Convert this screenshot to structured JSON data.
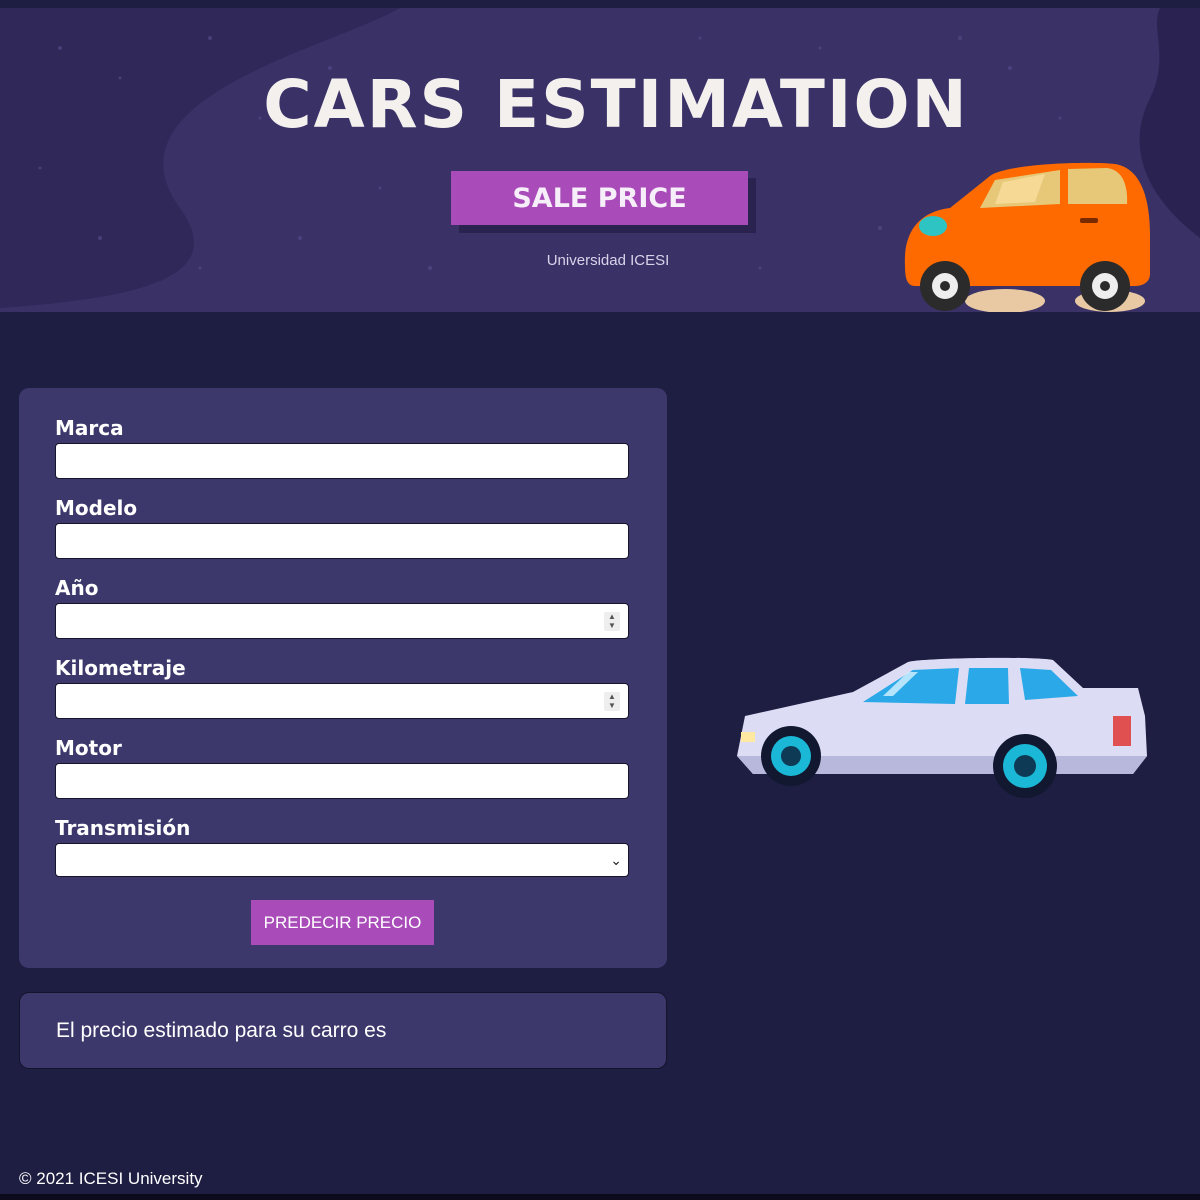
{
  "banner": {
    "title": "CARS ESTIMATION",
    "badge": "SALE PRICE",
    "subtitle": "Universidad ICESI",
    "illustration_icon": "orange-car-icon"
  },
  "form": {
    "fields": [
      {
        "label": "Marca",
        "value": "",
        "type": "text"
      },
      {
        "label": "Modelo",
        "value": "",
        "type": "text"
      },
      {
        "label": "Año",
        "value": "",
        "type": "number"
      },
      {
        "label": "Kilometraje",
        "value": "",
        "type": "number"
      },
      {
        "label": "Motor",
        "value": "",
        "type": "text"
      },
      {
        "label": "Transmisión",
        "value": "",
        "type": "select"
      }
    ],
    "submit_label": "PREDECIR PRECIO"
  },
  "result": {
    "text": "El precio estimado para su carro es"
  },
  "side_illustration": "white-car-icon",
  "footer": {
    "text": "© 2021 ICESI University"
  },
  "colors": {
    "background": "#1e1d42",
    "banner": "#3a3267",
    "card": "#3c386b",
    "accent": "#a94cba"
  }
}
